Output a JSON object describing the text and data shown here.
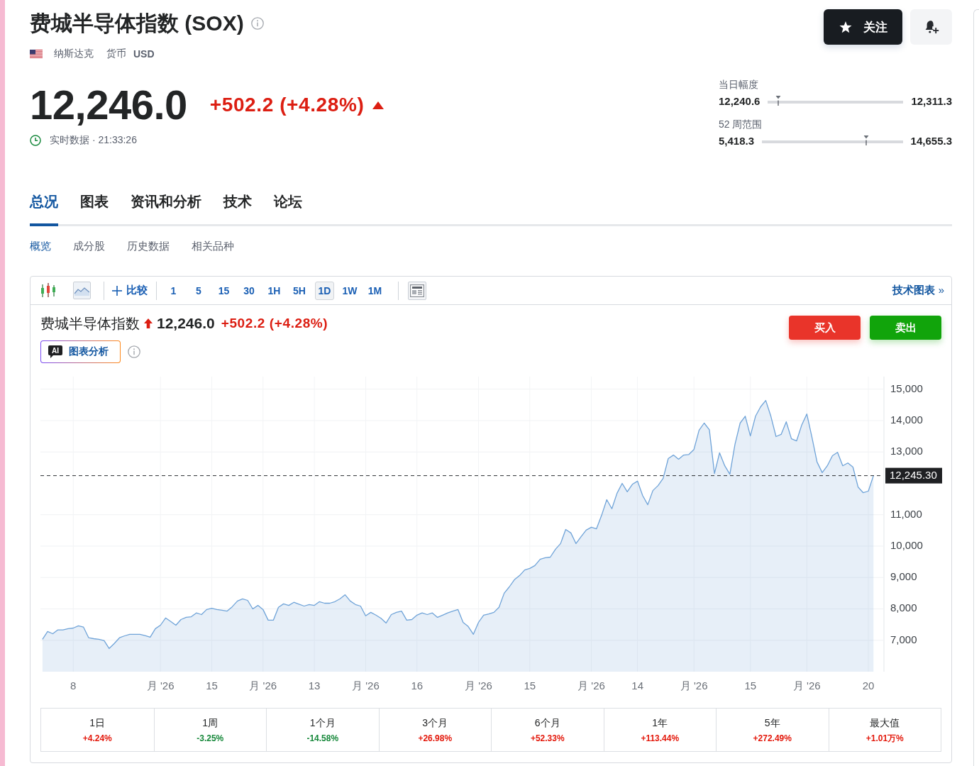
{
  "header": {
    "title": "费城半导体指数 (SOX)",
    "exchange": "纳斯达克",
    "currency_label": "货币",
    "currency": "USD"
  },
  "quote": {
    "price": "12,246.0",
    "change": "+502.2 (+4.28%)",
    "rising": true,
    "status": "实时数据 · 21:33:26"
  },
  "actions": {
    "follow": "关注"
  },
  "ranges": [
    {
      "label": "当日幅度",
      "low": "12,240.6",
      "high": "12,311.3",
      "level": 0.076
    },
    {
      "label": "52 周范围",
      "low": "5,418.3",
      "high": "14,655.3",
      "level": 0.739
    }
  ],
  "tabs": [
    {
      "label": "总况",
      "selected": true
    },
    {
      "label": "图表",
      "selected": false
    },
    {
      "label": "资讯和分析",
      "selected": false
    },
    {
      "label": "技术",
      "selected": false
    },
    {
      "label": "论坛",
      "selected": false
    }
  ],
  "subtabs": [
    {
      "label": "概览",
      "selected": true
    },
    {
      "label": "成分股",
      "selected": false
    },
    {
      "label": "历史数据",
      "selected": false
    },
    {
      "label": "相关品种",
      "selected": false
    }
  ],
  "toolbar": {
    "chart_types": [
      {
        "kind": "candlestick",
        "selected": false
      },
      {
        "kind": "area",
        "selected": true
      }
    ],
    "compare": "比较",
    "intervals": [
      {
        "label": "1",
        "selected": false
      },
      {
        "label": "5",
        "selected": false
      },
      {
        "label": "15",
        "selected": false
      },
      {
        "label": "30",
        "selected": false
      },
      {
        "label": "1H",
        "selected": false
      },
      {
        "label": "5H",
        "selected": false
      },
      {
        "label": "1D",
        "selected": true
      },
      {
        "label": "1W",
        "selected": false
      },
      {
        "label": "1M",
        "selected": false
      }
    ],
    "link": "**技术图表** »"
  },
  "chart_head": {
    "name": "费城半导体指数",
    "rising": true,
    "price": "12,246.0",
    "change": "+502.2 (+4.28%)",
    "buy": "买入",
    "sell": "卖出",
    "ai_badge": "AI",
    "ai_label": "图表分析"
  },
  "chart_data": {
    "type": "area",
    "grid": true,
    "categories": [
      null,
      null,
      null,
      null,
      null,
      null,
      "8",
      null,
      null,
      null,
      null,
      null,
      null,
      null,
      null,
      null,
      null,
      null,
      null,
      null,
      null,
      null,
      null,
      "月 '26",
      null,
      null,
      null,
      null,
      null,
      null,
      null,
      null,
      null,
      "15",
      null,
      null,
      null,
      null,
      null,
      null,
      null,
      null,
      null,
      "月 '26",
      null,
      null,
      null,
      null,
      null,
      null,
      null,
      null,
      null,
      "13",
      null,
      null,
      null,
      null,
      null,
      null,
      null,
      null,
      null,
      "月 '26",
      null,
      null,
      null,
      null,
      null,
      null,
      null,
      null,
      null,
      "16",
      null,
      null,
      null,
      null,
      null,
      null,
      null,
      null,
      null,
      null,
      null,
      "月 '26",
      null,
      null,
      null,
      null,
      null,
      null,
      null,
      null,
      null,
      "15",
      null,
      null,
      null,
      null,
      null,
      null,
      null,
      null,
      null,
      null,
      null,
      "月 '26",
      null,
      null,
      null,
      null,
      null,
      null,
      null,
      null,
      "14",
      null,
      null,
      null,
      null,
      null,
      null,
      null,
      null,
      null,
      null,
      "月 '26",
      null,
      null,
      null,
      null,
      null,
      null,
      null,
      null,
      null,
      null,
      "15",
      null,
      null,
      null,
      null,
      null,
      null,
      null,
      null,
      null,
      null,
      "月 '26",
      null,
      null,
      null,
      null,
      null,
      null,
      null,
      null,
      null,
      null,
      null,
      "20",
      null
    ],
    "ylim": [
      6000,
      15400
    ],
    "yticks": [
      {
        "value": 7000,
        "label": "7,000"
      },
      {
        "value": 8000,
        "label": "8,000"
      },
      {
        "value": 9000,
        "label": "9,000"
      },
      {
        "value": 10000,
        "label": "10,000"
      },
      {
        "value": 11000,
        "label": "11,000"
      },
      {
        "value": 13000,
        "label": "13,000"
      },
      {
        "value": 14000,
        "label": "14,000"
      },
      {
        "value": 15000,
        "label": "15,000"
      }
    ],
    "series": [
      {
        "color": "#6fa3d8",
        "values": [
          7030,
          7280,
          7210,
          7330,
          7330,
          7370,
          7390,
          7460,
          7420,
          7080,
          7050,
          7030,
          6990,
          6740,
          6900,
          7080,
          7140,
          7190,
          7190,
          7190,
          7150,
          7100,
          7370,
          7480,
          7710,
          7600,
          7480,
          7660,
          7730,
          7750,
          7870,
          7820,
          7980,
          8020,
          7980,
          7960,
          7930,
          8070,
          8250,
          8320,
          8270,
          8000,
          8110,
          7980,
          7640,
          7640,
          8050,
          8160,
          8110,
          8210,
          8150,
          8090,
          8140,
          8110,
          8230,
          8180,
          8180,
          8230,
          8320,
          8450,
          8250,
          8140,
          8090,
          7780,
          7890,
          7800,
          7700,
          7550,
          7820,
          7890,
          7930,
          7640,
          7660,
          7800,
          7870,
          7820,
          7870,
          7730,
          7800,
          7870,
          7930,
          7980,
          7570,
          7440,
          7190,
          7570,
          7800,
          7840,
          7890,
          8050,
          8500,
          8700,
          8930,
          9060,
          9240,
          9290,
          9380,
          9580,
          9630,
          9650,
          9900,
          10080,
          10530,
          10420,
          10080,
          10300,
          10510,
          10600,
          10550,
          10980,
          11480,
          11190,
          11680,
          12000,
          11730,
          11970,
          12070,
          11610,
          11320,
          11770,
          11930,
          12160,
          12790,
          12900,
          12770,
          12900,
          12920,
          13080,
          13690,
          13920,
          13710,
          12310,
          12970,
          12560,
          12290,
          13240,
          13920,
          14140,
          13510,
          14140,
          14440,
          14640,
          14140,
          13490,
          13560,
          13960,
          13420,
          13350,
          13850,
          14210,
          13470,
          12680,
          12340,
          12560,
          12880,
          12990,
          12560,
          12650,
          12520,
          11880,
          11700,
          11750,
          12250
        ]
      }
    ],
    "ref_lines": [
      {
        "axis": "y",
        "value": 12245.3,
        "label": "12,245.30"
      }
    ]
  },
  "performance": [
    {
      "period": "1日",
      "change": "+4.24%",
      "color": "#e3170a"
    },
    {
      "period": "1周",
      "change": "-3.25%",
      "color": "#16883a"
    },
    {
      "period": "1个月",
      "change": "-14.58%",
      "color": "#16883a"
    },
    {
      "period": "3个月",
      "change": "+26.98%",
      "color": "#e3170a"
    },
    {
      "period": "6个月",
      "change": "+52.33%",
      "color": "#e3170a"
    },
    {
      "period": "1年",
      "change": "+113.44%",
      "color": "#e3170a"
    },
    {
      "period": "5年",
      "change": "+272.49%",
      "color": "#e3170a"
    },
    {
      "period": "最大值",
      "change": "+1.01万%",
      "color": "#e3170a"
    }
  ]
}
